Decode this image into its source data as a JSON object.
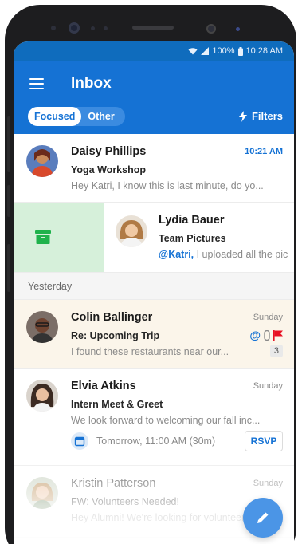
{
  "status_bar": {
    "battery": "100%",
    "time": "10:28 AM"
  },
  "header": {
    "title": "Inbox",
    "tabs": {
      "focused": "Focused",
      "other": "Other"
    },
    "filters_label": "Filters"
  },
  "mails_top": [
    {
      "sender": "Daisy Phillips",
      "subject": "Yoga Workshop",
      "preview": "Hey Katri, I know this is last minute, do yo...",
      "time": "10:21 AM"
    },
    {
      "sender": "Lydia Bauer",
      "subject": "Team Pictures",
      "mention": "@Katri,",
      "preview": " I uploaded all the pic"
    }
  ],
  "section_yesterday": "Yesterday",
  "mails_yesterday": [
    {
      "sender": "Colin Ballinger",
      "subject": "Re: Upcoming Trip",
      "preview": "I found these restaurants near our...",
      "time": "Sunday",
      "count": "3"
    },
    {
      "sender": "Elvia Atkins",
      "subject": "Intern Meet & Greet",
      "preview": "We look forward to welcoming our fall inc...",
      "time": "Sunday",
      "event_time": "Tomorrow, 11:00 AM (30m)",
      "rsvp": "RSVP"
    },
    {
      "sender": "Kristin Patterson",
      "subject": "FW: Volunteers Needed!",
      "preview": "Hey Alumni! We're looking for volunteers...",
      "time": "Sunday"
    }
  ],
  "colors": {
    "brand_blue": "#1572d4",
    "archive_green": "#1fb24b",
    "flag_red": "#e81123"
  }
}
